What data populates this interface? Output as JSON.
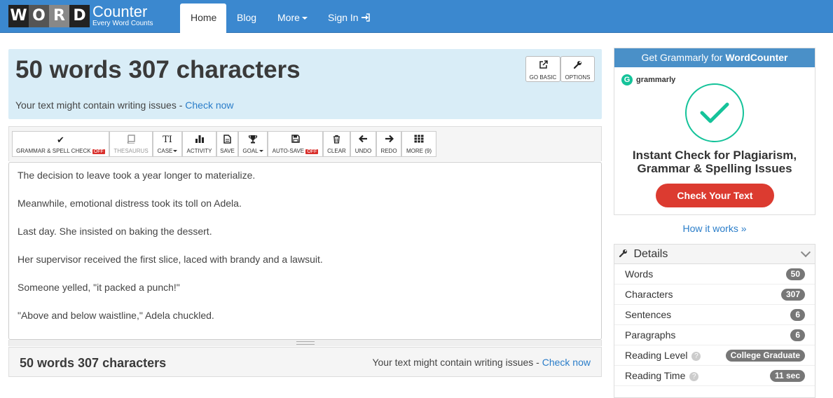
{
  "logo": {
    "letters": [
      "W",
      "O",
      "R",
      "D"
    ],
    "brand": "Counter",
    "tagline": "Every Word Counts"
  },
  "nav": {
    "home": "Home",
    "blog": "Blog",
    "more": "More",
    "signin": "Sign In"
  },
  "stats": {
    "title": "50 words 307 characters",
    "issues_text": "Your text might contain writing issues - ",
    "check_now": "Check now",
    "go_basic": "GO BASIC",
    "options": "OPTIONS"
  },
  "toolbar": {
    "grammar": "GRAMMAR & SPELL CHECK",
    "grammar_state": "OFF",
    "thesaurus": "THESAURUS",
    "case": "CASE",
    "activity": "ACTIVITY",
    "save": "SAVE",
    "goal": "GOAL",
    "autosave": "AUTO-SAVE",
    "autosave_state": "OFF",
    "clear": "CLEAR",
    "undo": "UNDO",
    "redo": "REDO",
    "more": "MORE (9)"
  },
  "editor": {
    "lines": [
      "The decision to leave took a year longer to materialize.",
      "Meanwhile, emotional distress took its toll on Adela.",
      "Last day. She insisted on baking the dessert.",
      "Her supervisor received the first slice, laced with brandy and a lawsuit.",
      "Someone yelled, \"it packed a punch!\"",
      "\"Above and below waistline,\" Adela chuckled."
    ]
  },
  "bottom": {
    "count": "50 words 307 characters",
    "issues_text": "Your text might contain writing issues - ",
    "check_now": "Check now"
  },
  "ad": {
    "head_pre": "Get ",
    "head_brand": "Grammarly",
    "head_mid": " for ",
    "head_site": "WordCounter",
    "logo_text": "grammarly",
    "title_line1": "Instant Check for Plagiarism,",
    "title_line2": "Grammar & Spelling Issues",
    "button": "Check Your Text"
  },
  "how_it_works": "How it works »",
  "details": {
    "title": "Details",
    "rows": [
      {
        "label": "Words",
        "value": "50"
      },
      {
        "label": "Characters",
        "value": "307"
      },
      {
        "label": "Sentences",
        "value": "6"
      },
      {
        "label": "Paragraphs",
        "value": "6"
      },
      {
        "label": "Reading Level",
        "value": "College Graduate"
      },
      {
        "label": "Reading Time",
        "value": "11 sec"
      }
    ]
  },
  "colors": {
    "navbar": "#3b88cf",
    "info_panel": "#d9edf7",
    "link": "#2a7dc9",
    "grammarly_green": "#15c39a",
    "ad_button": "#dc3b30"
  }
}
